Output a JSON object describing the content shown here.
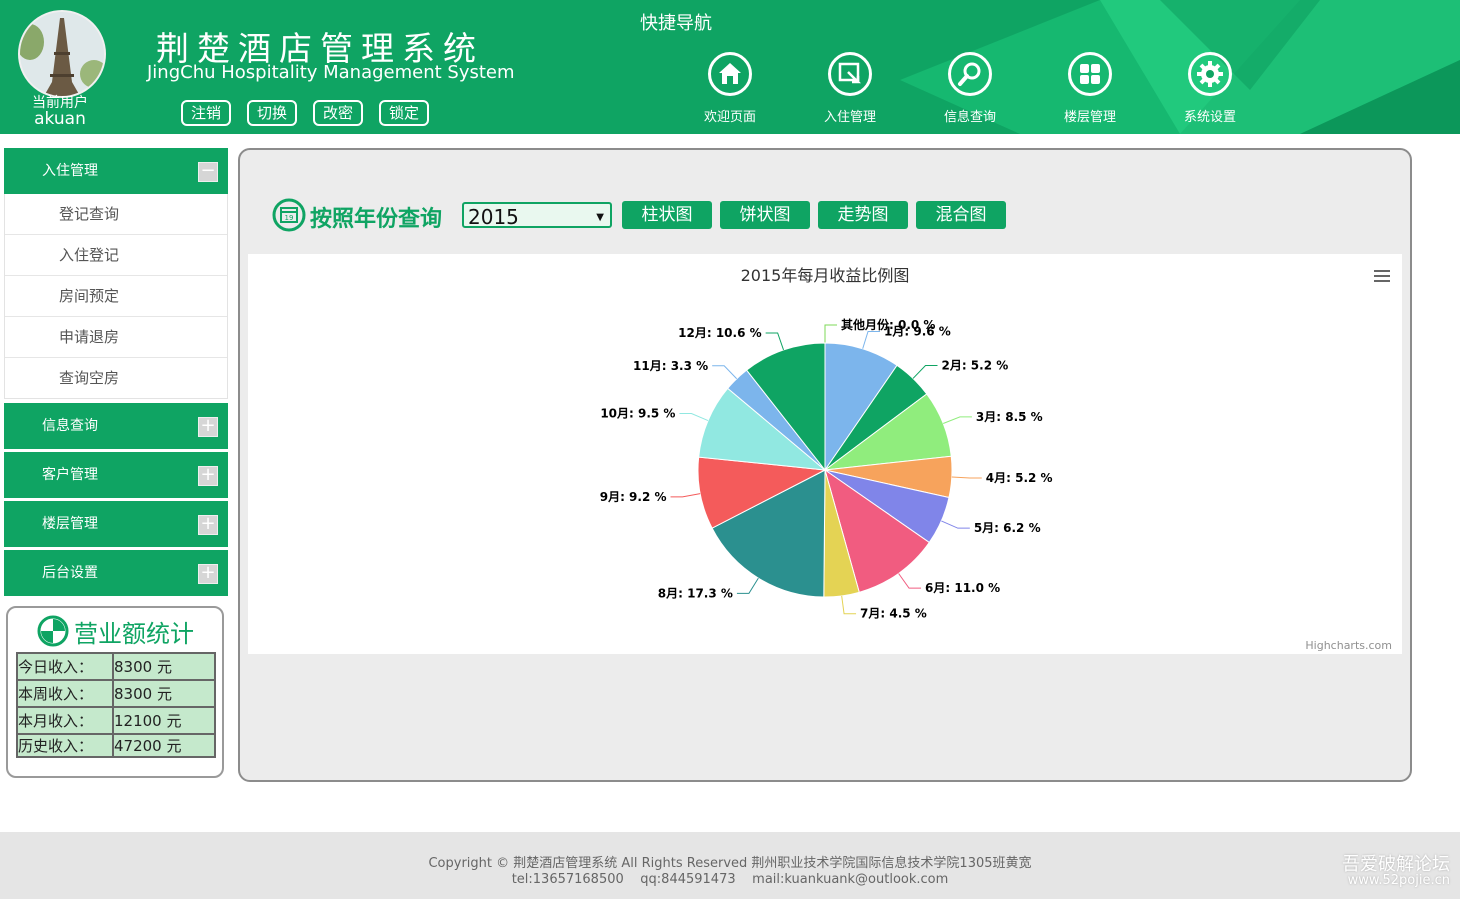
{
  "header": {
    "title": "荆楚酒店管理系统",
    "subtitle": "JingChu Hospitality Management System",
    "current_user_caption": "当前用户",
    "current_user_name": "akuan",
    "buttons": [
      "注销",
      "切换",
      "改密",
      "锁定"
    ],
    "quick_nav_title": "快捷导航",
    "nav": [
      {
        "label": "欢迎页面",
        "icon": "home-icon"
      },
      {
        "label": "入住管理",
        "icon": "checkin-icon"
      },
      {
        "label": "信息查询",
        "icon": "search-icon"
      },
      {
        "label": "楼层管理",
        "icon": "grid-icon"
      },
      {
        "label": "系统设置",
        "icon": "gear-icon"
      }
    ]
  },
  "sidebar": {
    "sections": [
      {
        "label": "入住管理",
        "toggle": "−",
        "items": [
          "登记查询",
          "入住登记",
          "房间预定",
          "申请退房",
          "查询空房"
        ]
      },
      {
        "label": "信息查询",
        "toggle": "+"
      },
      {
        "label": "客户管理",
        "toggle": "+"
      },
      {
        "label": "楼层管理",
        "toggle": "+"
      },
      {
        "label": "后台设置",
        "toggle": "+"
      }
    ],
    "stats": {
      "title": "营业额统计",
      "rows": [
        {
          "label": "今日收入：",
          "value": "8300 元"
        },
        {
          "label": "本周收入：",
          "value": "8300 元"
        },
        {
          "label": "本月收入：",
          "value": "12100 元"
        },
        {
          "label": "历史收入：",
          "value": "47200 元"
        }
      ]
    }
  },
  "main": {
    "query_title": "按照年份查询",
    "year_selected": "2015",
    "chart_buttons": [
      "柱状图",
      "饼状图",
      "走势图",
      "混合图"
    ],
    "credits": "Highcharts.com"
  },
  "chart_data": {
    "type": "pie",
    "title": "2015年每月收益比例图",
    "categories": [
      "其他月份",
      "1月",
      "2月",
      "3月",
      "4月",
      "5月",
      "6月",
      "7月",
      "8月",
      "9月",
      "10月",
      "11月",
      "12月"
    ],
    "values": [
      0.0,
      9.6,
      5.2,
      8.5,
      5.2,
      6.2,
      11.0,
      4.5,
      17.3,
      9.2,
      9.5,
      3.3,
      10.6
    ],
    "labels": [
      "其他月份: 0.0 %",
      "1月: 9.6 %",
      "2月: 5.2 %",
      "3月: 8.5 %",
      "4月: 5.2 %",
      "5月: 6.2 %",
      "6月: 11.0 %",
      "7月: 4.5 %",
      "8月: 17.3 %",
      "9月: 9.2 %",
      "10月: 9.5 %",
      "11月: 3.3 %",
      "12月: 10.6 %"
    ],
    "colors": [
      "#7ed957",
      "#7cb5ec",
      "#0fa463",
      "#90ed7d",
      "#f7a35c",
      "#8085e9",
      "#f15c80",
      "#e4d354",
      "#2b908f",
      "#f45b5b",
      "#91e8e1",
      "#7cb5ec",
      "#0fa463"
    ]
  },
  "footer": {
    "line1": "Copyright © 荆楚酒店管理系统 All Rights Reserved 荆州职业技术学院国际信息技术学院1305班黄宽",
    "line2": "tel:13657168500    qq:844591473    mail:kuankuank@outlook.com",
    "watermark1": "吾爱破解论坛",
    "watermark2": "www.52pojie.cn"
  },
  "colors": {
    "brand": "#0fa463",
    "stats_cell": "#c5e9cc"
  }
}
